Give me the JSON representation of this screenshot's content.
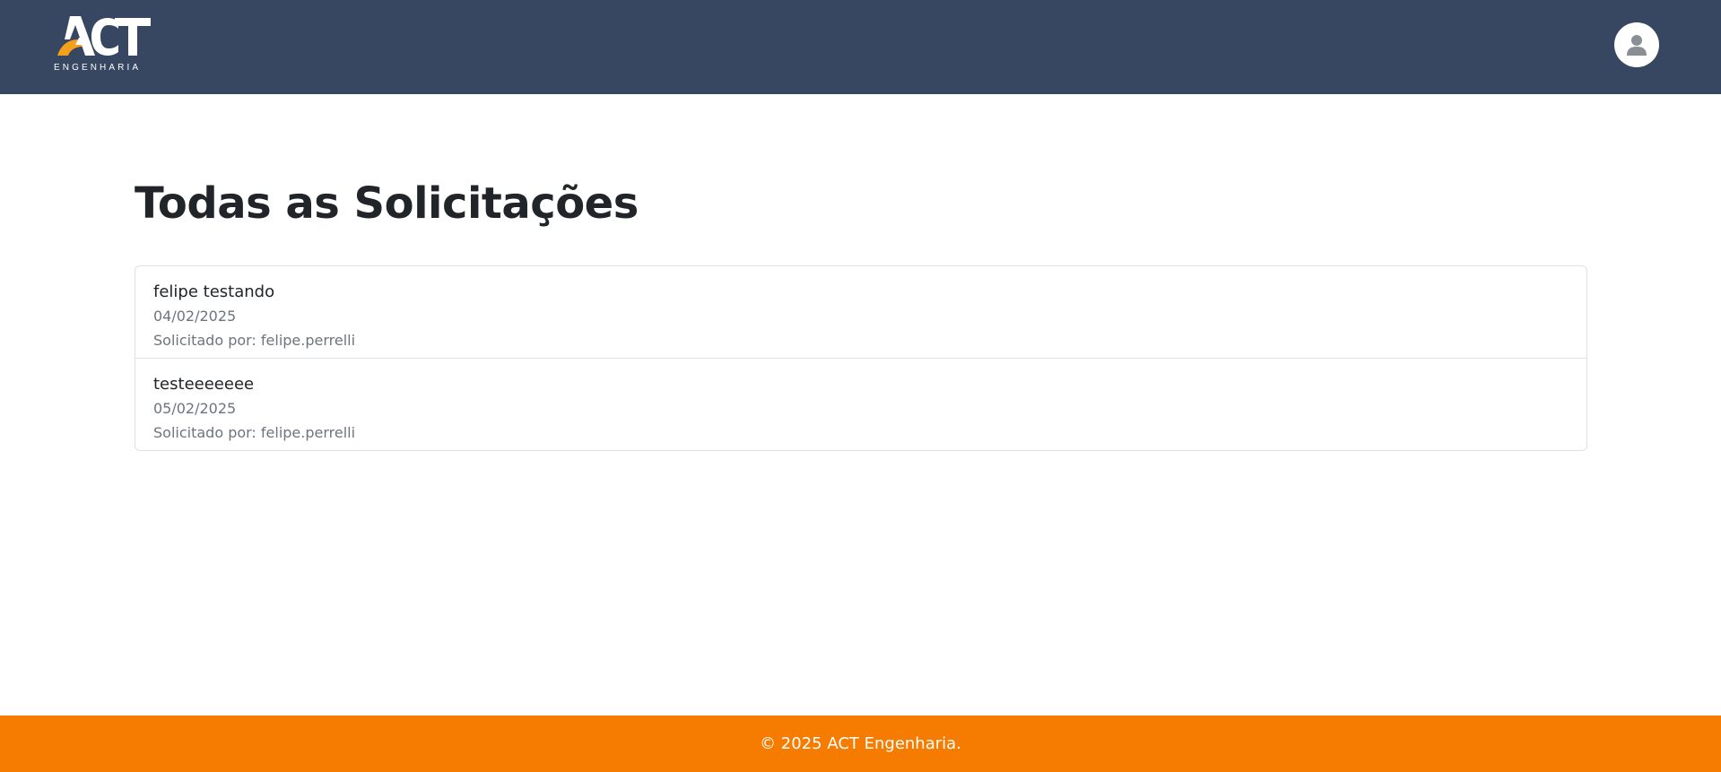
{
  "header": {
    "logo_text": "ACT",
    "logo_subtitle": "ENGENHARIA",
    "user_icon": "user-icon"
  },
  "main": {
    "title": "Todas as Solicitações",
    "requests": [
      {
        "title": "felipe testando",
        "date": "04/02/2025",
        "requested_by": "Solicitado por: felipe.perrelli"
      },
      {
        "title": "testeeeeeee",
        "date": "05/02/2025",
        "requested_by": "Solicitado por: felipe.perrelli"
      }
    ]
  },
  "footer": {
    "text": "© 2025 ACT Engenharia."
  },
  "colors": {
    "navbar": "#374761",
    "accent": "#f57c00",
    "muted_text": "#6c757d"
  }
}
